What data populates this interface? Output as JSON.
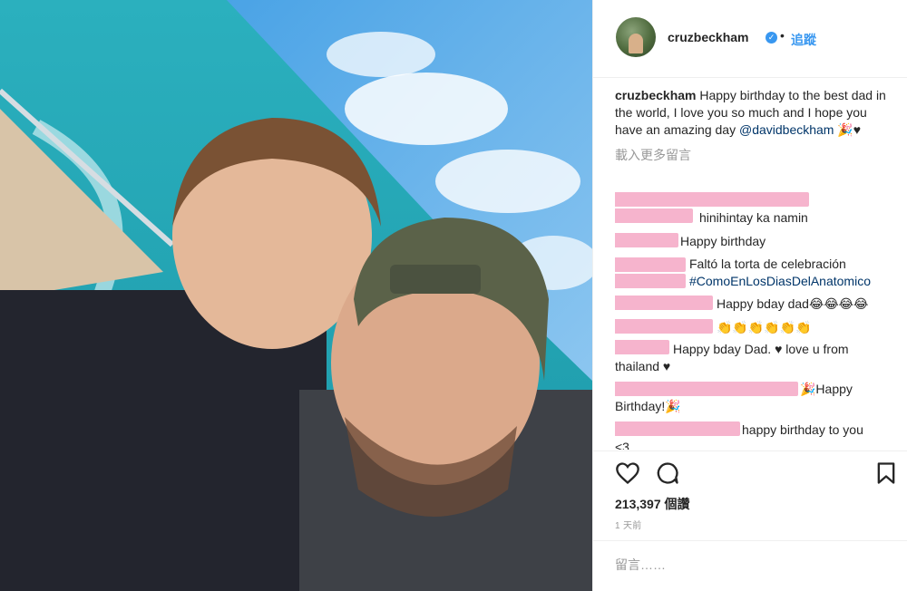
{
  "post": {
    "username": "cruzbeckham",
    "verified_badge": "✓",
    "dot": "•",
    "follow_label": "追蹤",
    "caption_user": "cruzbeckham",
    "caption_text": " Happy birthday to the best dad in the world, I love you so much and I hope you have an amazing day ",
    "caption_mention": "@davidbeckham",
    "caption_tail": " 🎉♥",
    "load_more": "載入更多留言",
    "likes": "213,397 個讚",
    "time": "1 天前",
    "comment_placeholder": "留言……"
  },
  "comments": [
    {
      "text": "hinihintay ka namin"
    },
    {
      "text": "Happy birthday"
    },
    {
      "text": "Faltó la torta de celebración",
      "tag": "#ComoEnLosDiasDelAnatomico"
    },
    {
      "text": "Happy bday dad😂😂😂😂"
    },
    {
      "text": "👏👏👏👏👏👏"
    },
    {
      "text": "Happy bday Dad. ♥ love u from",
      "text2": "thailand ♥"
    },
    {
      "text": "🎉Happy",
      "text2": "Birthday!🎉"
    },
    {
      "text": "happy birthday to you",
      "text2": "<3"
    }
  ],
  "icons": {
    "like": "heart-icon",
    "comment": "comment-bubble-icon",
    "save": "bookmark-icon",
    "avatar": "avatar"
  },
  "colors": {
    "link": "#3897f0",
    "mention": "#003569",
    "blur": "#f6b4cd",
    "muted": "#999999"
  }
}
